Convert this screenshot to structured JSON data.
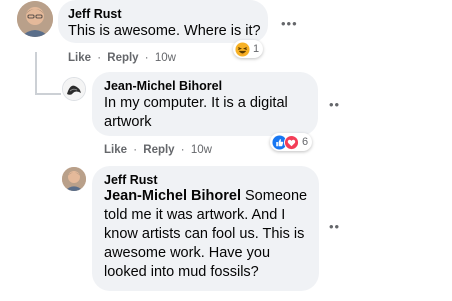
{
  "comments": [
    {
      "author": "Jeff Rust",
      "text": "This is awesome. Where is it?",
      "reaction_count": "1",
      "reaction_icons": [
        "haha-icon"
      ],
      "like_label": "Like",
      "reply_label": "Reply",
      "time": "10w"
    },
    {
      "author": "Jean-Michel Bihorel",
      "text": "In my computer. It is a digital artwork",
      "reaction_count": "6",
      "reaction_icons": [
        "like-icon",
        "love-icon"
      ],
      "like_label": "Like",
      "reply_label": "Reply",
      "time": "10w"
    },
    {
      "author": "Jeff Rust",
      "mention": "Jean-Michel Bihorel",
      "text": "Someone told me it was artwork. And I know artists can fool us. This is awesome work. Have you looked into mud fossils?"
    }
  ],
  "meta_separator": "·",
  "more_glyph": "•••",
  "more_glyph_small": "••",
  "colors": {
    "bubble": "#f0f2f5",
    "meta": "#65676b",
    "like_blue": "#1877f2",
    "love_red": "#f33e58",
    "haha_yellow": "#f7b125"
  }
}
